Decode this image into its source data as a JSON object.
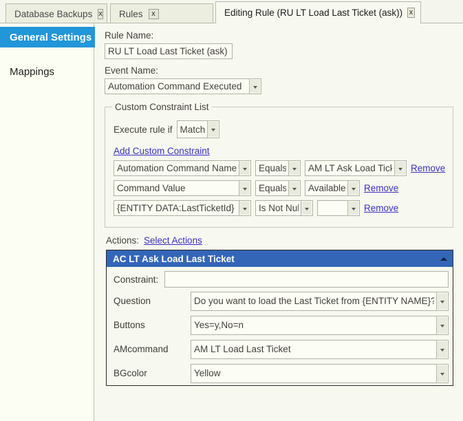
{
  "tabs": [
    {
      "label": "Database Backups",
      "close": "x",
      "active": false
    },
    {
      "label": "Rules",
      "close": "x",
      "active": false
    },
    {
      "label": "Editing Rule (RU LT Load Last Ticket (ask))",
      "close": "x",
      "active": true
    }
  ],
  "sidebar": {
    "items": [
      {
        "label": "General Settings",
        "active": true
      },
      {
        "label": "Mappings",
        "active": false
      }
    ]
  },
  "form": {
    "rule_name_label": "Rule Name:",
    "rule_name_value": "RU LT Load Last Ticket (ask)",
    "event_name_label": "Event Name:",
    "event_name_value": "Automation Command Executed"
  },
  "constraints": {
    "legend": "Custom Constraint List",
    "execute_rule_if_label": "Execute rule if",
    "match_mode": "Matches",
    "add_link": "Add Custom Constraint",
    "remove_label": "Remove",
    "rows": [
      {
        "field": "Automation Command Name",
        "operator": "Equals",
        "value": "AM LT Ask Load Ticket",
        "remove": "Remove"
      },
      {
        "field": "Command Value",
        "operator": "Equals",
        "value": "Available",
        "remove": "Remove"
      },
      {
        "field": "{ENTITY DATA:LastTicketId}",
        "operator": "Is Not Null",
        "value": "",
        "remove": "Remove"
      }
    ]
  },
  "actions": {
    "label": "Actions:",
    "select_link": "Select Actions",
    "panel": {
      "title": "AC LT Ask Load Last Ticket",
      "collapse_icon": "caret-up-icon",
      "constraint_label": "Constraint:",
      "constraint_value": "",
      "properties": [
        {
          "name": "Question",
          "value": "Do you want to load the Last Ticket from {ENTITY NAME}?"
        },
        {
          "name": "Buttons",
          "value": "Yes=y,No=n"
        },
        {
          "name": "AMcommand",
          "value": "AM LT Load Last Ticket"
        },
        {
          "name": "BGcolor",
          "value": "Yellow"
        }
      ]
    }
  },
  "colors": {
    "sidebar_active": "#2196d8",
    "panel_header": "#3366b7",
    "link": "#3b2fc0",
    "page_bg": "#f7f8ef"
  }
}
